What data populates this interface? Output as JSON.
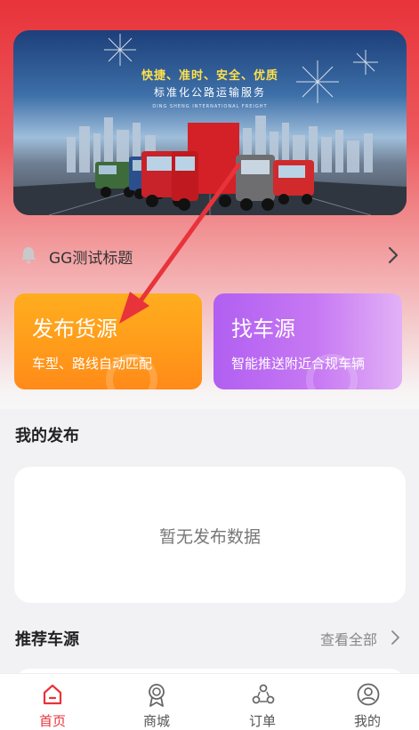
{
  "banner": {
    "slogan": "快捷、准时、安全、优质",
    "subtitle": "标准化公路运输服务",
    "english": "DING SHENG INTERNATIONAL FREIGHT"
  },
  "notice": {
    "icon": "bell-icon",
    "text": "GG测试标题",
    "chevron_icon": "chevron-right-icon"
  },
  "actions": {
    "publish": {
      "title": "发布货源",
      "subtitle": "车型、路线自动匹配",
      "color": "#ff9a1a"
    },
    "find": {
      "title": "找车源",
      "subtitle": "智能推送附近合规车辆",
      "color": "#b15ff1"
    }
  },
  "my_posts": {
    "title": "我的发布",
    "empty_text": "暂无发布数据"
  },
  "recommended": {
    "title": "推荐车源",
    "view_all": "查看全部"
  },
  "tabbar": {
    "items": [
      {
        "label": "首页",
        "icon": "home-icon",
        "active": true
      },
      {
        "label": "商城",
        "icon": "medal-icon",
        "active": false
      },
      {
        "label": "订单",
        "icon": "order-icon",
        "active": false
      },
      {
        "label": "我的",
        "icon": "user-icon",
        "active": false
      }
    ]
  },
  "colors": {
    "brand_red": "#e8333a",
    "orange": "#ff9a1a",
    "purple": "#b15ff1"
  }
}
